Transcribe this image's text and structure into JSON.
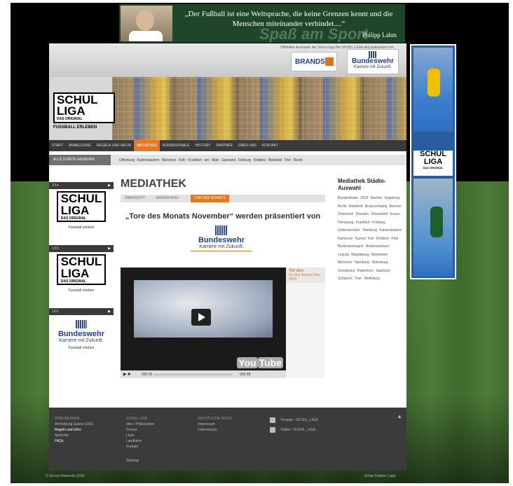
{
  "quote": {
    "text": "„Der Fußball ist eine Weltsprache, die keine Grenzen kennt und die Menschen miteinander verbindet....“",
    "author": "Philipp Lahm",
    "slogan": "Spaß am Sport"
  },
  "header": {
    "top_text": "Offizieller Ausrüster der Schul-Liga     Die SCHUL-LIGA wird präsentiert von",
    "brands_label": "BRANDS",
    "bundeswehr_name": "Bundeswehr",
    "bundeswehr_slogan": "Karriere mit Zukunft.",
    "logo_line1": "SCHUL",
    "logo_line2": "LIGA",
    "logo_orig": "DAS ORIGINAL",
    "logo_sub": "FUSSBALL ERLEBEN"
  },
  "nav": {
    "items": [
      "START",
      "ANMELDUNG",
      "REGELN UND INFOS",
      "MEDIATHEK",
      "BUNDESFINALE",
      "HISTORY",
      "PARTNER",
      "ÜBER UNS",
      "KONTAKT"
    ],
    "active_index": 3
  },
  "cities": {
    "button": "ALLE STÄDTE ANSEHEN",
    "list": "Offenburg  Kaiserslautern  München  Köln  Frankfurt am Main  Saarland  Freiburg  Koblenz  Bielefeld  Trier  Berlin"
  },
  "sidebar": {
    "box1": {
      "bar": "1/14",
      "line1": "SCHUL",
      "line2": "LIGA",
      "orig": "DAS ORIGINAL",
      "caption": "Fussball erleben"
    },
    "box2": {
      "bar": "1/10",
      "line1": "SCHUL",
      "line2": "LIGA",
      "orig": "DAS ORIGINAL",
      "caption": "Fussball erleben"
    },
    "box3": {
      "bar": "1/21",
      "name": "Bundeswehr",
      "slogan": "Karriere mit Zukunft.",
      "caption": "Fussball erleben"
    }
  },
  "content": {
    "title": "MEDIATHEK",
    "subnav": [
      "ÜBERSICHT",
      "SAISON 09/10",
      "TOR DES MONATS"
    ],
    "subnav_active": 2,
    "headline": "„Tore des Monats November“ werden präsentiert von",
    "sponsor_name": "Bundeswehr",
    "sponsor_slogan": "Karriere mit Zukunft.",
    "video": {
      "time_start": "000:00",
      "time_end": "000:58",
      "progress": 0,
      "logo_you": "You",
      "logo_tube": "Tube"
    },
    "tor": {
      "title": "Tor des",
      "subtitle": "Tor des Monats Nov 2010"
    }
  },
  "right": {
    "title": "Mediathek Städte-Auswahl",
    "cities": "Bundesfinale 2010  Aachen  Augsburg  Berlin  Bielefeld  Braunschweig  Bremen  Dortmund  Dresden  Düsseldorf  Essen  Flensburg  Frankfurt  Freiburg  Gelsenkirchen  Hamburg  Kaiserslautern  Karlsruhe  Kassel  Kiel  Koblenz  Köln  Bodenseeregion  Niedersachsen  Leipzig  Magdeburg  Mannheim  München  Nürnberg  Oldenburg  Osnabrück  Paderborn  Saarland  Schwerin  Trier  Wolfsburg"
  },
  "footer": {
    "col1": {
      "head": "SPIELBETRIEB",
      "l1": "Anmeldung Saison 10/11",
      "l2": "Regeln und Infos",
      "l3": "Spielorte",
      "l4": "FAQs"
    },
    "col2": {
      "head": "SCHUL-LIGA",
      "l1": "Idee / Philosophie",
      "l2": "Presse",
      "l3": "Links",
      "l4": "Landkarte",
      "l5": "Kontakt",
      "l6": "Sitemap"
    },
    "col3": {
      "head": "RECHTLICHE INFOS",
      "l1": "Impressum",
      "l2": "Datenschutz"
    },
    "social": {
      "youtube": "Youtube / SCHUL_LIGA",
      "twitter": "Twitter / SCHUL_LIGA"
    },
    "bottom_left": "© Soccer Networks 2010",
    "bottom_right": "Schul-Tribüne Login"
  },
  "right_banner": {
    "line1": "SCHUL",
    "line2": "LIGA",
    "orig": "DAS ORIGINAL"
  }
}
